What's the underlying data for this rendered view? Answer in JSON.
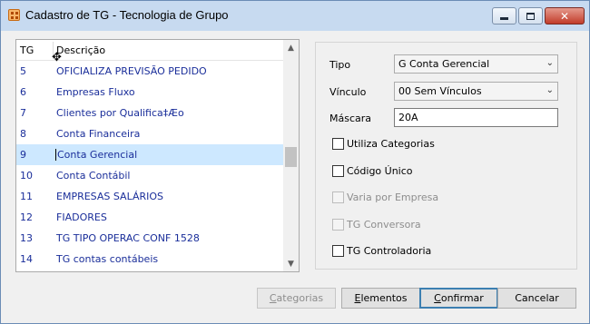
{
  "window": {
    "title": "Cadastro de TG - Tecnologia de Grupo",
    "minimize_glyph": "",
    "close_glyph": "✕"
  },
  "list": {
    "columns": [
      "TG",
      "Descrição"
    ],
    "rows": [
      {
        "tg": "5",
        "desc": "OFICIALIZA PREVISÃO PEDIDO"
      },
      {
        "tg": "6",
        "desc": "Empresas Fluxo"
      },
      {
        "tg": "7",
        "desc": "Clientes por Qualifica‡Æo"
      },
      {
        "tg": "8",
        "desc": "Conta Financeira"
      },
      {
        "tg": "9",
        "desc": "Conta Gerencial"
      },
      {
        "tg": "10",
        "desc": "Conta Contábil"
      },
      {
        "tg": "11",
        "desc": "EMPRESAS SALÁRIOS"
      },
      {
        "tg": "12",
        "desc": "FIADORES"
      },
      {
        "tg": "13",
        "desc": "TG TIPO OPERAC CONF 1528"
      },
      {
        "tg": "14",
        "desc": "TG contas contábeis"
      }
    ],
    "selected_index": 4,
    "scroll_up": "▲",
    "scroll_down": "▼"
  },
  "form": {
    "tipo": {
      "label": "Tipo",
      "value": "G Conta Gerencial"
    },
    "vinculo": {
      "label": "Vínculo",
      "value": "00 Sem Vínculos"
    },
    "mascara": {
      "label": "Máscara",
      "value": "20A"
    },
    "checks": [
      {
        "label": "Utiliza Categorias",
        "checked": false,
        "enabled": true
      },
      {
        "label": "Código Único",
        "checked": false,
        "enabled": true
      },
      {
        "label": "Varia por Empresa",
        "checked": false,
        "enabled": false
      },
      {
        "label": "TG Conversora",
        "checked": false,
        "enabled": false
      },
      {
        "label": "TG Controladoria",
        "checked": false,
        "enabled": true
      }
    ],
    "chevron": "⌄"
  },
  "buttons": {
    "categorias": {
      "first": "C",
      "rest": "ategorias"
    },
    "elementos": {
      "first": "E",
      "rest": "lementos"
    },
    "confirmar": {
      "first": "C",
      "rest": "onfirmar"
    },
    "cancelar": {
      "first": "",
      "rest": "Cancelar"
    }
  }
}
